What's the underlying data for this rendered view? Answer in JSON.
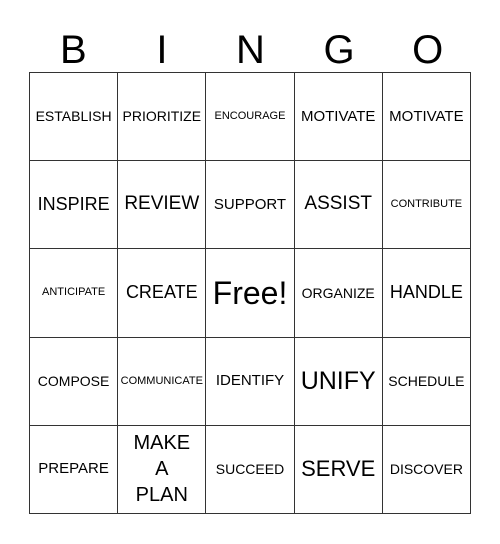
{
  "header": [
    "B",
    "I",
    "N",
    "G",
    "O"
  ],
  "cells": [
    [
      "ESTABLISH",
      "PRIORITIZE",
      "ENCOURAGE",
      "MOTIVATE",
      "MOTIVATE"
    ],
    [
      "INSPIRE",
      "REVIEW",
      "SUPPORT",
      "ASSIST",
      "CONTRIBUTE"
    ],
    [
      "ANTICIPATE",
      "CREATE",
      "Free!",
      "ORGANIZE",
      "HANDLE"
    ],
    [
      "COMPOSE",
      "COMMUNICATE",
      "IDENTIFY",
      "UNIFY",
      "SCHEDULE"
    ],
    [
      "PREPARE",
      "MAKE A PLAN",
      "SUCCEED",
      "SERVE",
      "DISCOVER"
    ]
  ]
}
